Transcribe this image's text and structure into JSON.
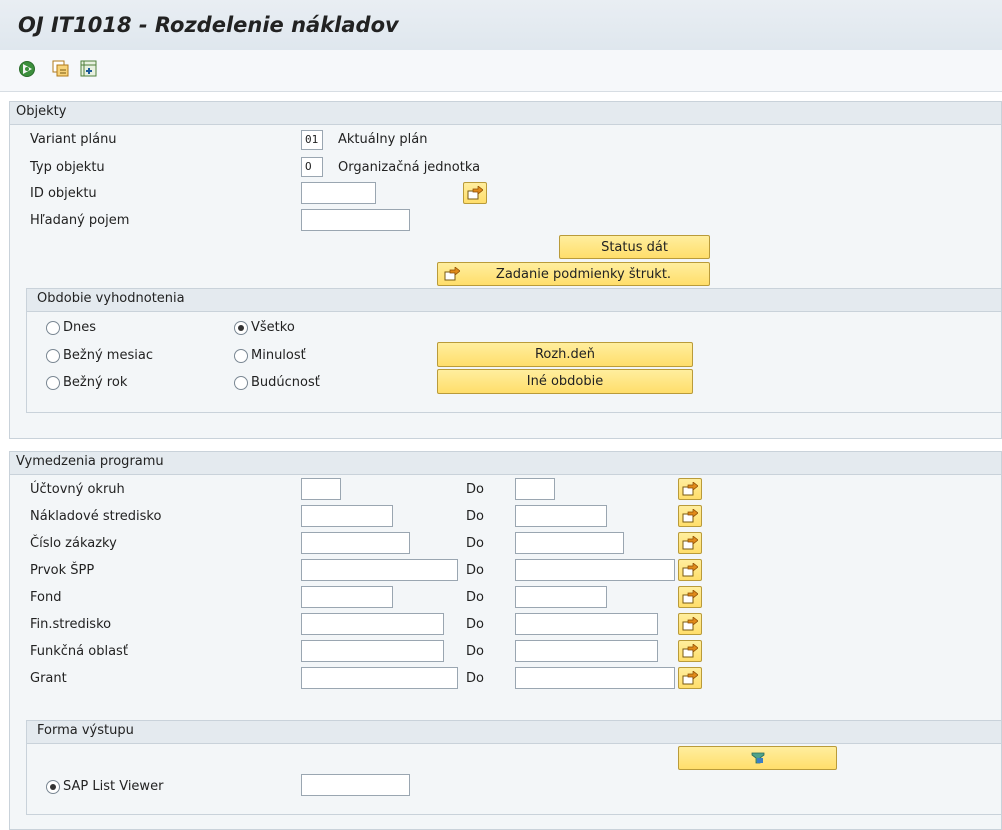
{
  "title": "OJ IT1018 - Rozdelenie nákladov",
  "toolbar": {
    "icons": [
      "execute-icon",
      "copy-variant-icon",
      "selection-options-icon"
    ]
  },
  "objects": {
    "header": "Objekty",
    "plan_variant": {
      "label": "Variant plánu",
      "value": "01",
      "text": "Aktuálny plán"
    },
    "object_type": {
      "label": "Typ objektu",
      "value": "O",
      "text": "Organizačná jednotka"
    },
    "object_id": {
      "label": "ID objektu",
      "value": ""
    },
    "search_term": {
      "label": "Hľadaný pojem",
      "value": ""
    },
    "status_button": "Status dát",
    "struct_button": "Zadanie podmienky štrukt."
  },
  "period": {
    "header": "Obdobie vyhodnotenia",
    "options": [
      {
        "label": "Dnes",
        "selected": false
      },
      {
        "label": "Bežný mesiac",
        "selected": false
      },
      {
        "label": "Bežný rok",
        "selected": false
      },
      {
        "label": "Všetko",
        "selected": true
      },
      {
        "label": "Minulosť",
        "selected": false
      },
      {
        "label": "Budúcnosť",
        "selected": false
      }
    ],
    "key_date_button": "Rozh.deň",
    "other_period_button": "Iné obdobie"
  },
  "program": {
    "header": "Vymedzenia programu",
    "to_label": "Do",
    "rows": [
      {
        "label": "Účtovný okruh",
        "from": "",
        "to": ""
      },
      {
        "label": "Nákladové stredisko",
        "from": "",
        "to": ""
      },
      {
        "label": "Číslo zákazky",
        "from": "",
        "to": ""
      },
      {
        "label": "Prvok ŠPP",
        "from": "",
        "to": ""
      },
      {
        "label": "Fond",
        "from": "",
        "to": ""
      },
      {
        "label": "Fin.stredisko",
        "from": "",
        "to": ""
      },
      {
        "label": "Funkčná oblasť",
        "from": "",
        "to": ""
      },
      {
        "label": "Grant",
        "from": "",
        "to": ""
      }
    ]
  },
  "output": {
    "header": "Forma výstupu",
    "radio": {
      "label": "SAP List Viewer",
      "selected": true
    },
    "layout_value": ""
  }
}
